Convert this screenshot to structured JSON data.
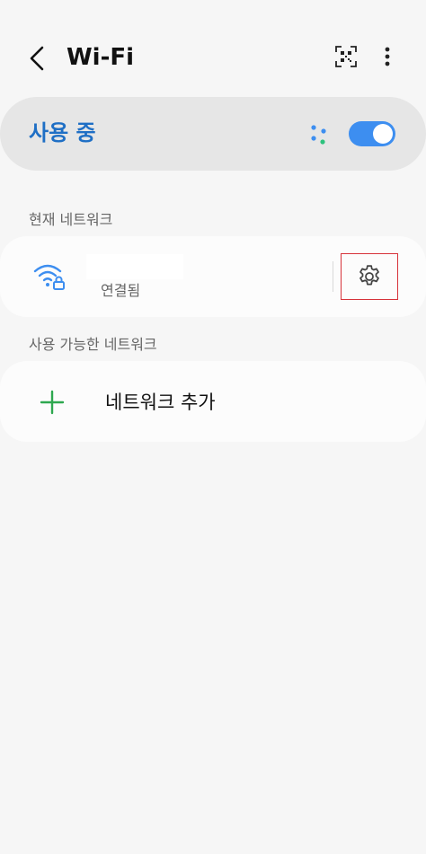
{
  "header": {
    "title": "Wi-Fi",
    "back_icon": "chevron-left-icon",
    "qr_icon": "qr-code-scan-icon",
    "more_icon": "more-vertical-icon"
  },
  "master": {
    "label": "사용 중",
    "toggle_on": true,
    "dots_icon": "connection-dots-icon"
  },
  "sections": {
    "current_network": "현재 네트워크",
    "available_networks": "사용 가능한 네트워크"
  },
  "current_network": {
    "status": "연결됨",
    "icon": "wifi-lock-icon",
    "settings_icon": "gear-icon"
  },
  "add_network": {
    "label": "네트워크 추가",
    "icon": "plus-icon"
  },
  "colors": {
    "accent": "#3d8ef0",
    "active_text": "#1f6fc5",
    "add_icon": "#2ea84f",
    "highlight_border": "#d6323a",
    "background": "#f6f6f6",
    "card": "#fcfcfc"
  }
}
